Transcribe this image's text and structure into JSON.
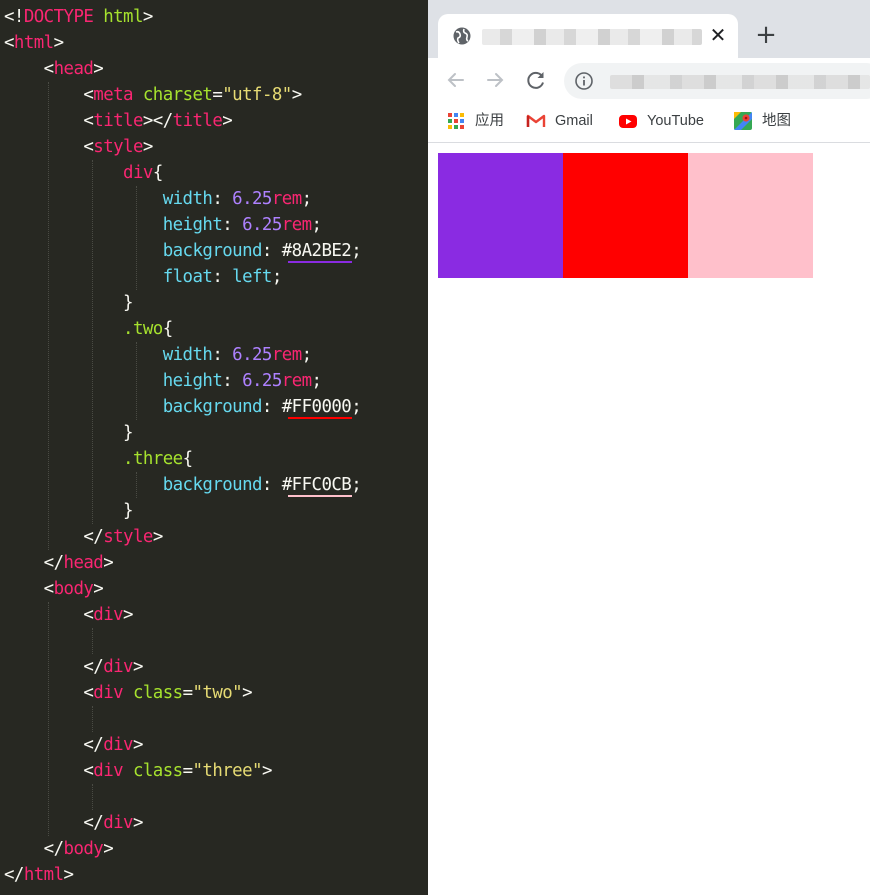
{
  "editor": {
    "lines": [
      [
        {
          "t": "<!",
          "c": "t-punct"
        },
        {
          "t": "DOCTYPE",
          "c": "t-tag"
        },
        {
          "t": " html",
          "c": "t-attr"
        },
        {
          "t": ">",
          "c": "t-punct"
        }
      ],
      [
        {
          "t": "<",
          "c": "t-punct"
        },
        {
          "t": "html",
          "c": "t-tag"
        },
        {
          "t": ">",
          "c": "t-punct"
        }
      ],
      [
        {
          "t": "    <",
          "c": "t-punct"
        },
        {
          "t": "head",
          "c": "t-tag"
        },
        {
          "t": ">",
          "c": "t-punct"
        }
      ],
      [
        {
          "t": "        <",
          "c": "t-punct"
        },
        {
          "t": "meta",
          "c": "t-tag"
        },
        {
          "t": " charset",
          "c": "t-attr"
        },
        {
          "t": "=",
          "c": "t-punct"
        },
        {
          "t": "\"utf-8\"",
          "c": "t-str"
        },
        {
          "t": ">",
          "c": "t-punct"
        }
      ],
      [
        {
          "t": "        <",
          "c": "t-punct"
        },
        {
          "t": "title",
          "c": "t-tag"
        },
        {
          "t": "></",
          "c": "t-punct"
        },
        {
          "t": "title",
          "c": "t-tag"
        },
        {
          "t": ">",
          "c": "t-punct"
        }
      ],
      [
        {
          "t": "        <",
          "c": "t-punct"
        },
        {
          "t": "style",
          "c": "t-tag"
        },
        {
          "t": ">",
          "c": "t-punct"
        }
      ],
      [
        {
          "t": "            ",
          "c": "t-punct"
        },
        {
          "t": "div",
          "c": "t-sel"
        },
        {
          "t": "{",
          "c": "t-punct"
        }
      ],
      [
        {
          "t": "                width",
          "c": "t-prop"
        },
        {
          "t": ": ",
          "c": "t-punct"
        },
        {
          "t": "6.25",
          "c": "t-num"
        },
        {
          "t": "rem",
          "c": "t-unit"
        },
        {
          "t": ";",
          "c": "t-punct"
        }
      ],
      [
        {
          "t": "                height",
          "c": "t-prop"
        },
        {
          "t": ": ",
          "c": "t-punct"
        },
        {
          "t": "6.25",
          "c": "t-num"
        },
        {
          "t": "rem",
          "c": "t-unit"
        },
        {
          "t": ";",
          "c": "t-punct"
        }
      ],
      [
        {
          "t": "                background",
          "c": "t-prop"
        },
        {
          "t": ": ",
          "c": "t-punct"
        },
        {
          "t": "#8A2BE2",
          "c": "t-hash",
          "u": "#8a2be2"
        },
        {
          "t": ";",
          "c": "t-punct"
        }
      ],
      [
        {
          "t": "                float",
          "c": "t-prop"
        },
        {
          "t": ": ",
          "c": "t-punct"
        },
        {
          "t": "left",
          "c": "t-prop"
        },
        {
          "t": ";",
          "c": "t-punct"
        }
      ],
      [
        {
          "t": "            }",
          "c": "t-punct"
        }
      ],
      [
        {
          "t": "            ",
          "c": "t-punct"
        },
        {
          "t": ".two",
          "c": "t-cls"
        },
        {
          "t": "{",
          "c": "t-punct"
        }
      ],
      [
        {
          "t": "                width",
          "c": "t-prop"
        },
        {
          "t": ": ",
          "c": "t-punct"
        },
        {
          "t": "6.25",
          "c": "t-num"
        },
        {
          "t": "rem",
          "c": "t-unit"
        },
        {
          "t": ";",
          "c": "t-punct"
        }
      ],
      [
        {
          "t": "                height",
          "c": "t-prop"
        },
        {
          "t": ": ",
          "c": "t-punct"
        },
        {
          "t": "6.25",
          "c": "t-num"
        },
        {
          "t": "rem",
          "c": "t-unit"
        },
        {
          "t": ";",
          "c": "t-punct"
        }
      ],
      [
        {
          "t": "                background",
          "c": "t-prop"
        },
        {
          "t": ": ",
          "c": "t-punct"
        },
        {
          "t": "#FF0000",
          "c": "t-hash",
          "u": "#ff0000"
        },
        {
          "t": ";",
          "c": "t-punct"
        }
      ],
      [
        {
          "t": "            }",
          "c": "t-punct"
        }
      ],
      [
        {
          "t": "            ",
          "c": "t-punct"
        },
        {
          "t": ".three",
          "c": "t-cls"
        },
        {
          "t": "{",
          "c": "t-punct"
        }
      ],
      [
        {
          "t": "                background",
          "c": "t-prop"
        },
        {
          "t": ": ",
          "c": "t-punct"
        },
        {
          "t": "#FFC0CB",
          "c": "t-hash",
          "u": "#ffc0cb"
        },
        {
          "t": ";",
          "c": "t-punct"
        }
      ],
      [
        {
          "t": "            }",
          "c": "t-punct"
        }
      ],
      [
        {
          "t": "        </",
          "c": "t-punct"
        },
        {
          "t": "style",
          "c": "t-tag"
        },
        {
          "t": ">",
          "c": "t-punct"
        }
      ],
      [
        {
          "t": "    </",
          "c": "t-punct"
        },
        {
          "t": "head",
          "c": "t-tag"
        },
        {
          "t": ">",
          "c": "t-punct"
        }
      ],
      [
        {
          "t": "    <",
          "c": "t-punct"
        },
        {
          "t": "body",
          "c": "t-tag"
        },
        {
          "t": ">",
          "c": "t-punct"
        }
      ],
      [
        {
          "t": "        <",
          "c": "t-punct"
        },
        {
          "t": "div",
          "c": "t-tag"
        },
        {
          "t": ">",
          "c": "t-punct"
        }
      ],
      [],
      [
        {
          "t": "        </",
          "c": "t-punct"
        },
        {
          "t": "div",
          "c": "t-tag"
        },
        {
          "t": ">",
          "c": "t-punct"
        }
      ],
      [
        {
          "t": "        <",
          "c": "t-punct"
        },
        {
          "t": "div",
          "c": "t-tag"
        },
        {
          "t": " class",
          "c": "t-attr"
        },
        {
          "t": "=",
          "c": "t-punct"
        },
        {
          "t": "\"two\"",
          "c": "t-str"
        },
        {
          "t": ">",
          "c": "t-punct"
        }
      ],
      [],
      [
        {
          "t": "        </",
          "c": "t-punct"
        },
        {
          "t": "div",
          "c": "t-tag"
        },
        {
          "t": ">",
          "c": "t-punct"
        }
      ],
      [
        {
          "t": "        <",
          "c": "t-punct"
        },
        {
          "t": "div",
          "c": "t-tag"
        },
        {
          "t": " class",
          "c": "t-attr"
        },
        {
          "t": "=",
          "c": "t-punct"
        },
        {
          "t": "\"three\"",
          "c": "t-str"
        },
        {
          "t": ">",
          "c": "t-punct"
        }
      ],
      [],
      [
        {
          "t": "        </",
          "c": "t-punct"
        },
        {
          "t": "div",
          "c": "t-tag"
        },
        {
          "t": ">",
          "c": "t-punct"
        }
      ],
      [
        {
          "t": "    </",
          "c": "t-punct"
        },
        {
          "t": "body",
          "c": "t-tag"
        },
        {
          "t": ">",
          "c": "t-punct"
        }
      ],
      [
        {
          "t": "</",
          "c": "t-punct"
        },
        {
          "t": "html",
          "c": "t-tag"
        },
        {
          "t": ">",
          "c": "t-punct"
        }
      ]
    ]
  },
  "browser": {
    "tab_close_icon": "close-icon",
    "new_tab_label": "+",
    "nav_icons": [
      "back-arrow-icon",
      "forward-arrow-icon",
      "reload-icon",
      "info-icon"
    ],
    "bookmarks": [
      {
        "label": "应用",
        "icon": "apps-grid-icon"
      },
      {
        "label": "Gmail",
        "icon": "gmail-icon"
      },
      {
        "label": "YouTube",
        "icon": "youtube-icon"
      },
      {
        "label": "地图",
        "icon": "maps-icon"
      }
    ]
  },
  "page": {
    "boxes": [
      {
        "class": "div",
        "color": "#8A2BE2"
      },
      {
        "class": "two",
        "color": "#FF0000"
      },
      {
        "class": "three",
        "color": "#FFC0CB"
      }
    ]
  }
}
